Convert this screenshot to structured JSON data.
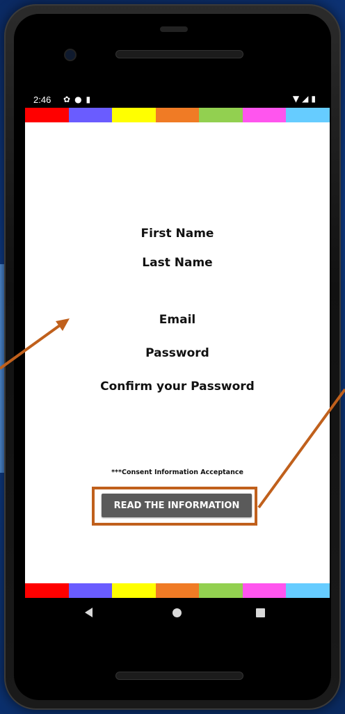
{
  "status_bar": {
    "time": "2:46",
    "left_icons": [
      "gear-icon",
      "shield-icon",
      "sd-card-icon"
    ],
    "right_icons": [
      "wifi-icon",
      "signal-icon",
      "battery-icon"
    ]
  },
  "color_strip": [
    "#ff0000",
    "#6a5cff",
    "#ffff00",
    "#f07b25",
    "#92d050",
    "#ff55ee",
    "#66ccff"
  ],
  "form": {
    "first_name_label": "First Name",
    "last_name_label": "Last Name",
    "email_label": "Email",
    "password_label": "Password",
    "confirm_password_label": "Confirm your Password"
  },
  "consent": {
    "text": "***Consent Information Acceptance",
    "button_label": "READ THE INFORMATION"
  },
  "annotations": {
    "arrow_color": "#c0601c"
  },
  "nav_bar": [
    "back-icon",
    "home-icon",
    "recents-icon"
  ]
}
